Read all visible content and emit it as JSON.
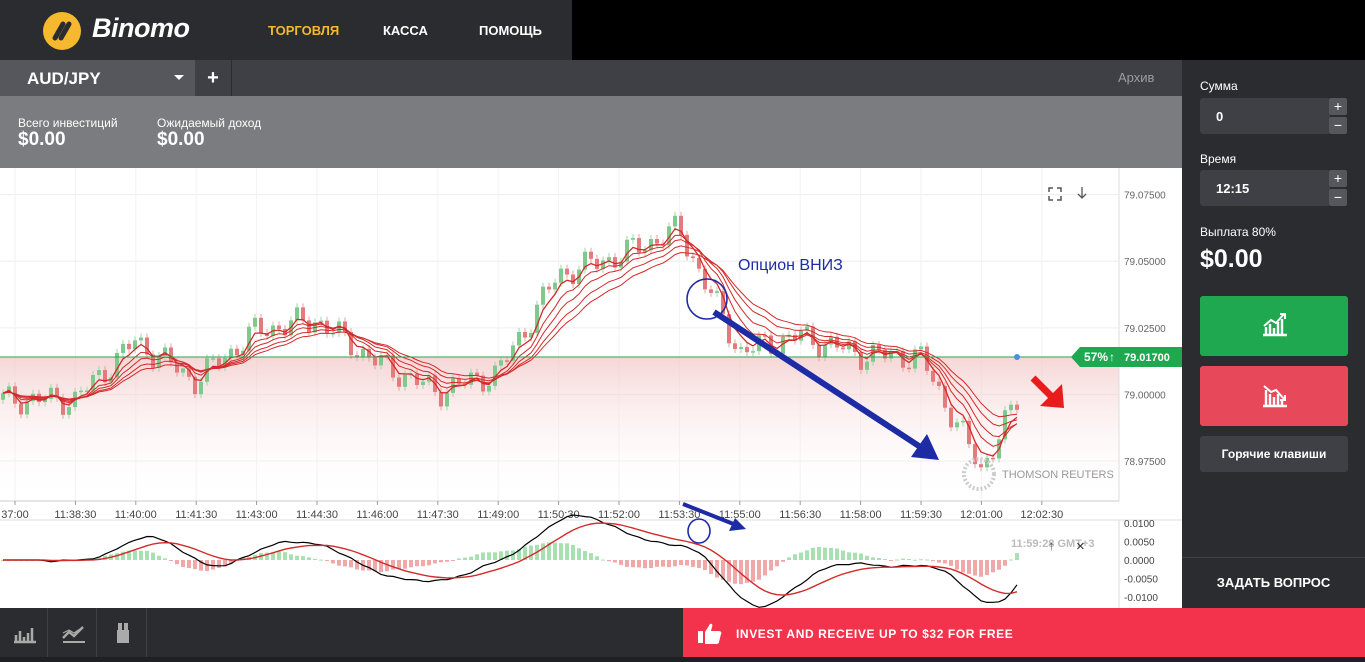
{
  "header": {
    "logo_text": "Binomo",
    "nav": [
      "ТОРГОВЛЯ",
      "КАССА",
      "ПОМОЩЬ"
    ],
    "nav_active_color": "#f5b82e"
  },
  "tabs": {
    "asset": "AUD/JPY",
    "add": "+",
    "archive": "Архив"
  },
  "info": {
    "total_label": "Всего инвестиций",
    "total_value": "$0.00",
    "expected_label": "Ожидаемый доход",
    "expected_value": "$0.00"
  },
  "chart": {
    "price_ticks": [
      "79.07500",
      "79.05000",
      "79.02500",
      "79.00000",
      "78.97500"
    ],
    "time_ticks": [
      "37:00",
      "11:38:30",
      "11:40:00",
      "11:41:30",
      "11:43:00",
      "11:44:30",
      "11:46:00",
      "11:47:30",
      "11:49:00",
      "11:50:30",
      "11:52:00",
      "11:53:30",
      "11:55:00",
      "11:56:30",
      "11:58:00",
      "11:59:30",
      "12:01:00",
      "12:02:30"
    ],
    "current_price": "79.01700",
    "percent": "57%",
    "percent_arrow": "↑",
    "annotation": "Опцион ВНИЗ",
    "watermark": "THOMSON REUTERS",
    "osc_ticks": [
      "0.0100",
      "0.0050",
      "0.0000",
      "-0.0050",
      "-0.0100"
    ],
    "osc_time": "11:59:28 GMT+3",
    "fullscreen_icon": "fullscreen-icon",
    "download_icon": "download-icon"
  },
  "chart_data": {
    "type": "line",
    "title": "",
    "x": [
      "11:38:30",
      "11:40:00",
      "11:41:30",
      "11:43:00",
      "11:44:30",
      "11:46:00",
      "11:47:30",
      "11:49:00",
      "11:50:30",
      "11:52:00",
      "11:53:30",
      "11:55:00",
      "11:56:30",
      "11:58:00",
      "11:59:30",
      "12:01:00",
      "12:02:30"
    ],
    "series": [
      {
        "values": [
          78.998,
          79.02,
          79.005,
          79.024,
          79.028,
          79.012,
          79.001,
          79.008,
          79.045,
          79.052,
          79.062,
          79.016,
          79.022,
          79.015,
          79.014,
          78.972,
          79.014
        ]
      }
    ],
    "ylim": [
      78.96,
      79.085
    ],
    "current": 79.017
  },
  "panel": {
    "amount_label": "Сумма",
    "amount_value": "0",
    "time_label": "Время",
    "time_value": "12:15",
    "payout_label": "Выплата 80%",
    "payout_value": "$0.00",
    "hotkeys": "Горячие клавиши",
    "ask": "ЗАДАТЬ ВОПРОС",
    "plus": "+",
    "minus": "−"
  },
  "promo": {
    "text": "INVEST AND RECEIVE UP TO $32 FOR FREE",
    "icon": "thumbs-up-icon"
  },
  "colors": {
    "up": "#1fa84f",
    "down": "#e8495a",
    "promo": "#f2334b",
    "ma": "#d42a2a"
  }
}
